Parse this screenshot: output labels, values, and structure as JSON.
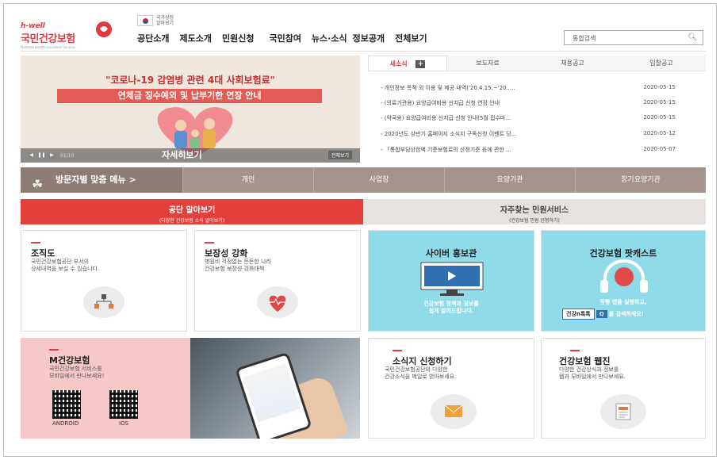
{
  "header": {
    "logo_small": "h-well",
    "logo_main": "국민건강보험",
    "logo_sub": "National Health Insurance Service",
    "gov_line1": "국가상징",
    "gov_line2": "알아보기",
    "nav": [
      "공단소개",
      "제도소개",
      "민원신청",
      "국민참여",
      "뉴스·소식",
      "정보공개",
      "전체보기"
    ],
    "search_placeholder": "통합검색"
  },
  "banner": {
    "title": "\"코로나-19 감염병 관련 4대 사회보험료\"",
    "band": "연체금 징수예외 및 납부기한 연장 안내",
    "caption": "자세히보기",
    "pager": "01/10",
    "all_label": "전체보기",
    "controls": [
      "◀",
      "❚❚",
      "▶"
    ]
  },
  "news": {
    "tabs": [
      "새소식",
      "보도자료",
      "채용공고",
      "입찰공고"
    ],
    "plus": "+",
    "items": [
      {
        "title": "- 개인정보 목적 외 이용 및 제공 내역('20.4.15.~'20.....",
        "date": "2020-05-15"
      },
      {
        "title": "- (의료기관용) 요양급여비용 선지급 신청 연장 안내",
        "date": "2020-05-15"
      },
      {
        "title": "- (약국용) 요양급여비용 선지급 신청 안내(5월 접수마...",
        "date": "2020-05-15"
      },
      {
        "title": "- 2020년도 상반기 홈페이지 소식지 구독신청 이벤트 당...",
        "date": "2020-05-12"
      },
      {
        "title": "- 「통합부담상한액 기준보험료의 산정기준 등에 관한 ...",
        "date": "2020-05-07"
      }
    ]
  },
  "visitor_menu": {
    "label": "방문자별 맞춤 메뉴 >",
    "items": [
      "개인",
      "사업장",
      "요양기관",
      "장기요양기관"
    ]
  },
  "sections": {
    "left_title": "공단 알아보기",
    "left_sub": "(다양한 건강보험 소식 알아보기)",
    "right_title": "자주찾는 민원서비스",
    "right_sub": "(건강보험 민원 신청하기)"
  },
  "cards": {
    "org": {
      "title": "조직도",
      "desc": "국민건강보험공단 부서의\n상세내역을 보실 수 있습니다."
    },
    "cover": {
      "title": "보장성 강화",
      "desc": "병원비 걱정없는 든든한 나라\n건강보험 보장성 강화대책"
    },
    "cyber": {
      "title": "사이버 홍보관",
      "desc": "건강보험 정책과 정보를\n쉽게 알려드립니다."
    },
    "podcast": {
      "title": "건강보험 팟캐스트",
      "desc": "팟빵 앱을 실행하고,",
      "search_box": "건강n톡톡",
      "search_btn": "Q",
      "desc2": "을 검색하세요!"
    },
    "mobile": {
      "title": "M건강보험",
      "desc": "국민건강보험 서비스를\n모바일에서 만나보세요!",
      "android": "ANDROID",
      "ios": "IOS"
    },
    "newsletter": {
      "title": "소식지 신청하기",
      "desc": "국민건강보험공단의 다양한\n건강소식을 메일로 받아보세요."
    },
    "webzine": {
      "title": "건강보험 웹진",
      "desc": "다양한 건강상식과 정보를\n웹과 모바일에서 만나보세요."
    }
  },
  "colors": {
    "brand_red": "#e03a3e",
    "menu_brown": "#a4948c",
    "cyan": "#8fdbe9",
    "pink": "#f6c8c8"
  }
}
